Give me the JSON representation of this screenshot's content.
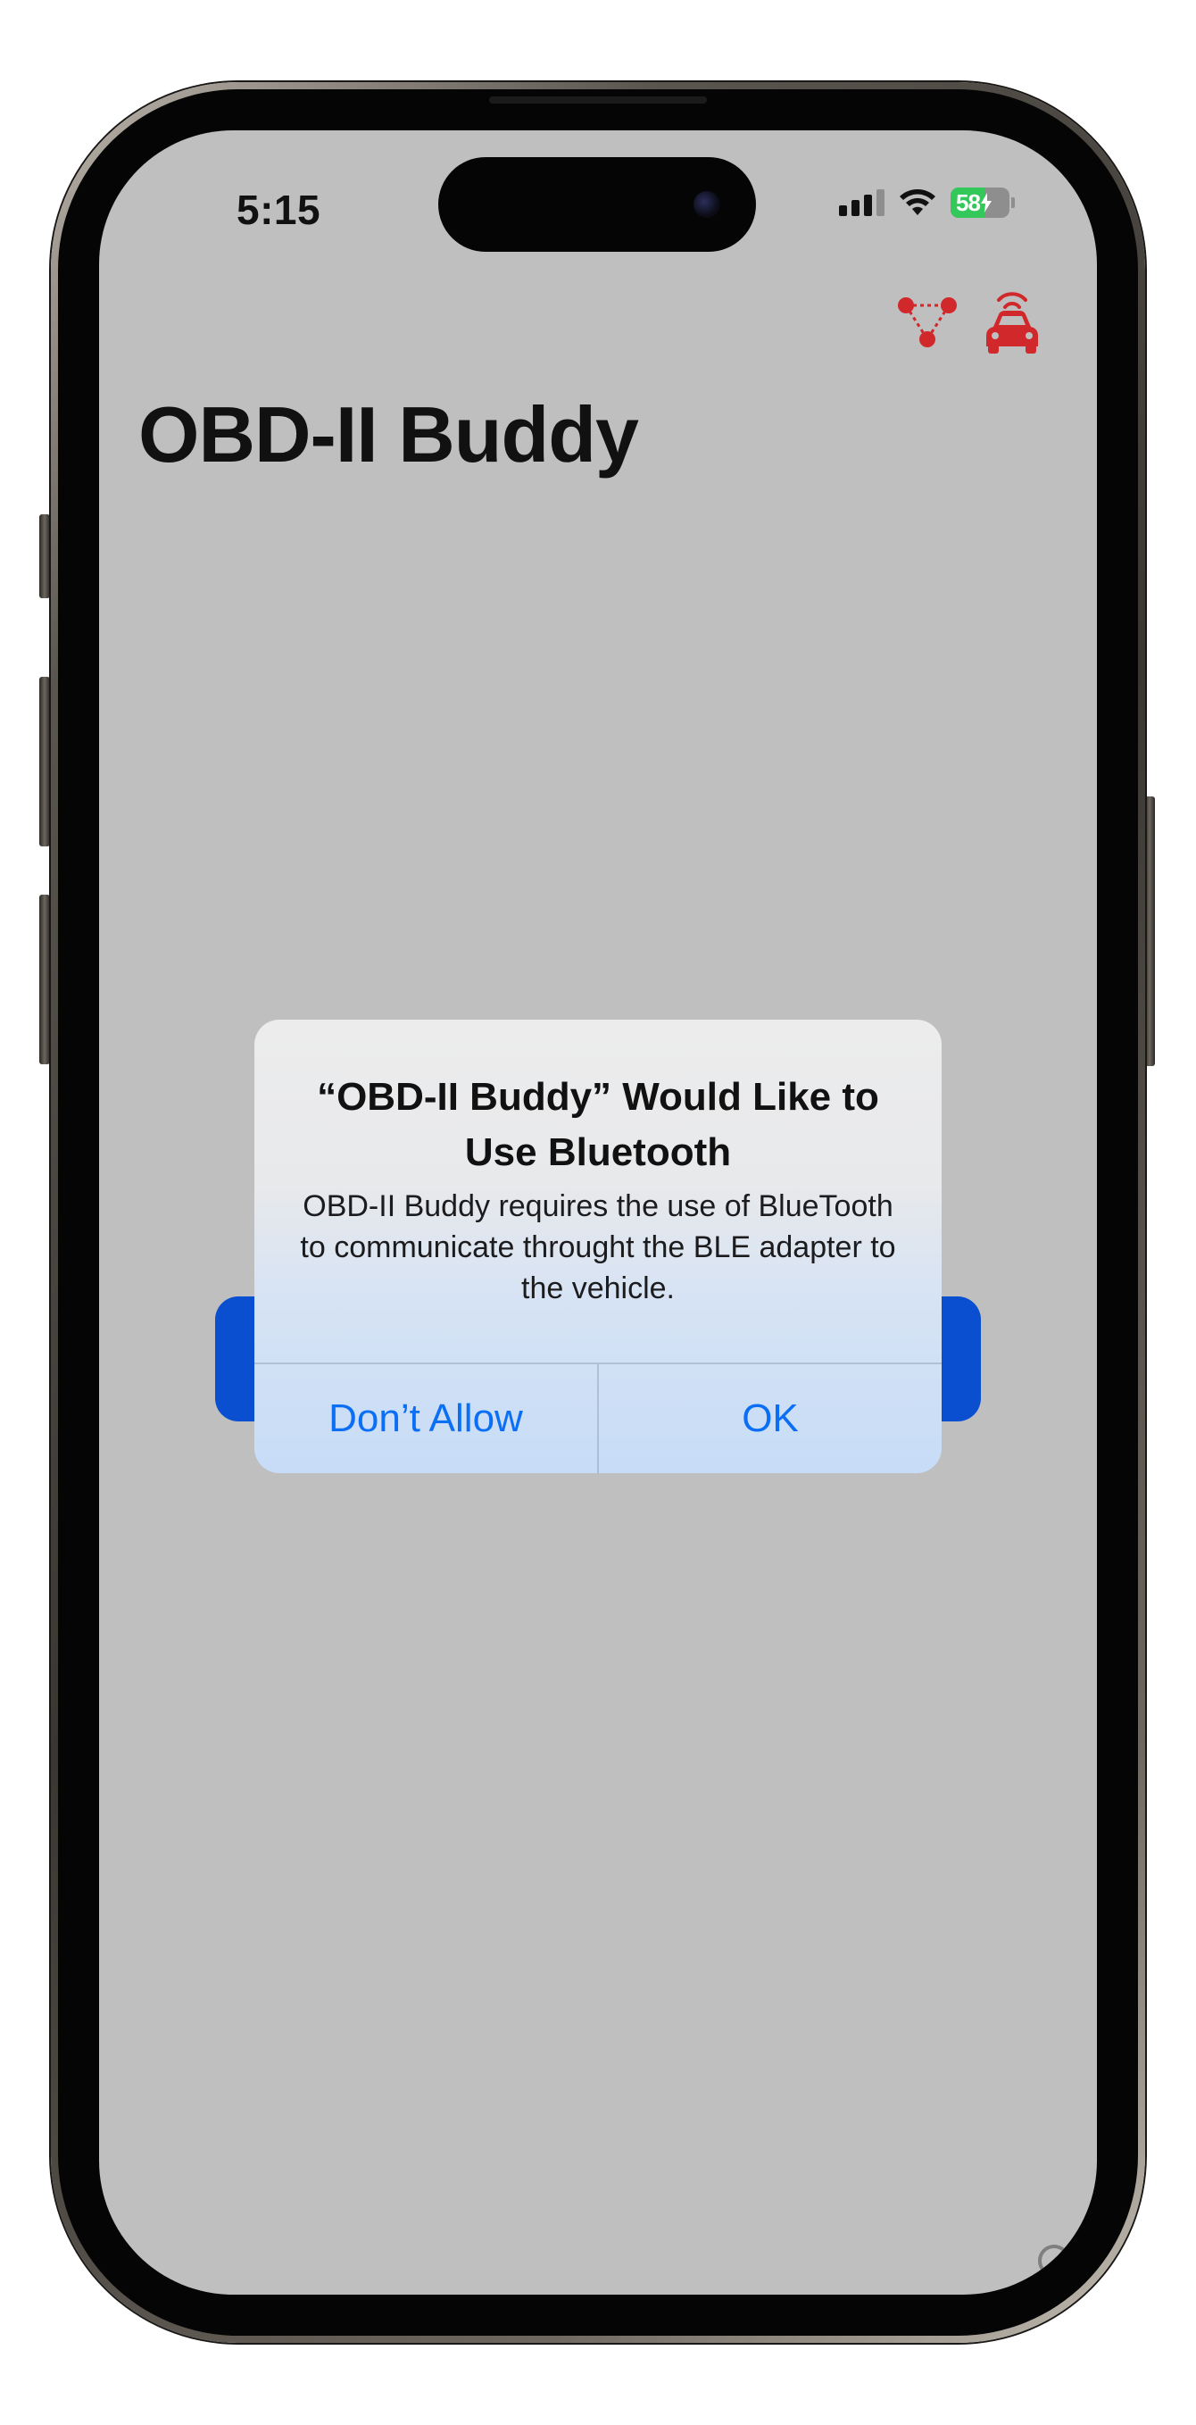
{
  "status_bar": {
    "time": "5:15",
    "battery_percent": "58",
    "battery_level": 0.58,
    "signal_bars_active": 3,
    "signal_bars_total": 4,
    "icons": [
      "cellular-signal-icon",
      "wifi-icon",
      "battery-charging-icon"
    ]
  },
  "toolbar": {
    "icons": [
      "network-nodes-icon",
      "car-wireless-icon"
    ],
    "icon_color": "#d0282b"
  },
  "nav": {
    "title": "OBD-II Buddy"
  },
  "alert": {
    "title": "“OBD-II Buddy” Would Like to Use Bluetooth",
    "message": "OBD-II Buddy requires the use of BlueTooth to communicate throught the BLE adapter to the vehicle.",
    "buttons": {
      "deny": "Don’t Allow",
      "ok": "OK"
    },
    "button_color": "#0a6ff5"
  },
  "colors": {
    "screen_dim": "#bfbfbf",
    "primary_button": "#0a4fd0",
    "battery_fill": "#34c759"
  }
}
